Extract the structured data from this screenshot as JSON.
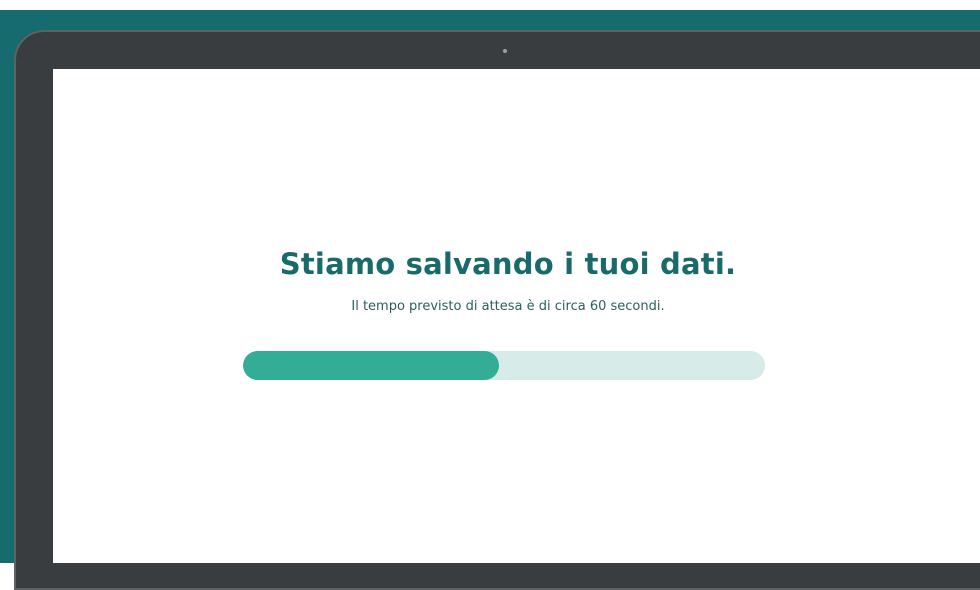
{
  "screen": {
    "title": "Stiamo salvando i tuoi dati.",
    "subtitle": "Il tempo previsto di attesa è di circa 60 secondi."
  },
  "progress": {
    "fraction": 0.49
  },
  "colors": {
    "backdrop": "#156b6e",
    "frame": "#3a3d40",
    "title": "#196a6a",
    "progress_fill": "#34ad96",
    "progress_track": "#d7ebe9"
  }
}
